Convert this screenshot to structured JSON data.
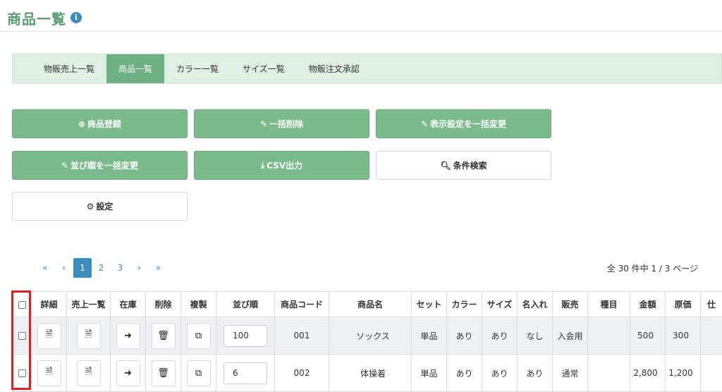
{
  "page": {
    "title": "商品一覧",
    "info_glyph": "i"
  },
  "tabs": [
    {
      "label": "物販売上一覧"
    },
    {
      "label": "商品一覧",
      "active": true
    },
    {
      "label": "カラー一覧"
    },
    {
      "label": "サイズ一覧"
    },
    {
      "label": "物販注文承認"
    }
  ],
  "actions": {
    "register": {
      "label": "商品登録",
      "icon": "plus-circle-icon"
    },
    "bulk_delete": {
      "label": "一括削除",
      "icon": "pencil-icon"
    },
    "bulk_display": {
      "label": "表示設定を一括変更",
      "icon": "pencil-icon"
    },
    "bulk_sort": {
      "label": "並び順を一括変更",
      "icon": "pencil-icon"
    },
    "csv": {
      "label": "CSV出力",
      "icon": "download-icon"
    },
    "search": {
      "label": "条件検索",
      "icon": "search-icon"
    },
    "settings": {
      "label": "設定",
      "icon": "gear-icon"
    }
  },
  "pagination": {
    "first": "«",
    "prev": "‹",
    "pages": [
      "1",
      "2",
      "3"
    ],
    "current": "1",
    "next": "›",
    "last": "»",
    "summary": "全 30 件中 1 / 3 ページ"
  },
  "table": {
    "headers": [
      "詳細",
      "売上一覧",
      "在庫",
      "削除",
      "複製",
      "並び順",
      "商品コード",
      "商品名",
      "セット",
      "カラー",
      "サイズ",
      "名入れ",
      "販売",
      "種目",
      "金額",
      "原価",
      "仕"
    ],
    "rows": [
      {
        "sort": "100",
        "code": "001",
        "name": "ソックス",
        "set": "単品",
        "color": "あり",
        "size": "あり",
        "naire": "なし",
        "sale": "入会用",
        "event": "",
        "price": "500",
        "cost": "300"
      },
      {
        "sort": "6",
        "code": "002",
        "name": "体操着",
        "set": "単品",
        "color": "あり",
        "size": "あり",
        "naire": "あり",
        "sale": "通常",
        "event": "",
        "price": "2,800",
        "cost": "1,200"
      }
    ]
  },
  "icons": {
    "detail": "file-icon",
    "sales": "file-icon",
    "stock": "arrow-right-icon",
    "delete": "trash-icon",
    "copy": "copy-icon"
  },
  "colors": {
    "accent_green": "#7bbb8b",
    "tab_active": "#6fb083",
    "link_blue": "#3c8dbc",
    "highlight_red": "#e01f1f"
  }
}
